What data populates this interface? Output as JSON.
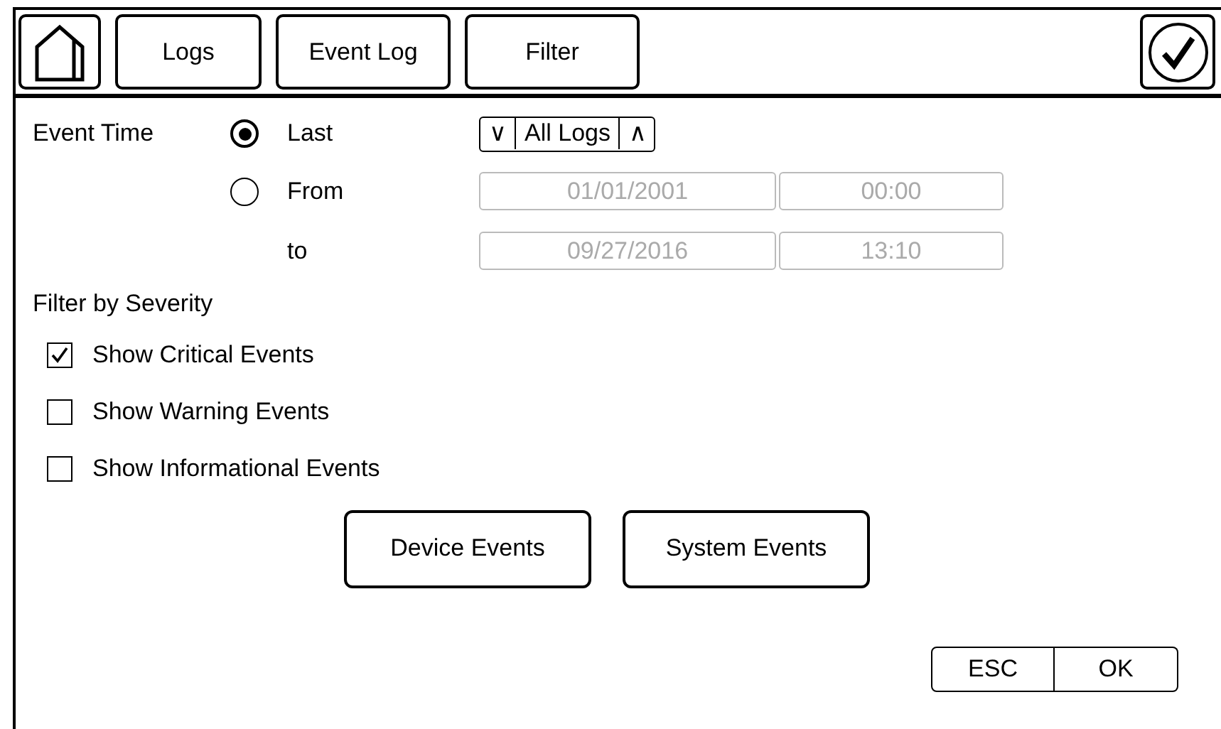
{
  "toolbar": {
    "tabs": [
      {
        "label": "Logs"
      },
      {
        "label": "Event Log"
      },
      {
        "label": "Filter"
      }
    ]
  },
  "event_time": {
    "label": "Event Time",
    "options": [
      {
        "label": "Last",
        "selected": true
      },
      {
        "label": "From",
        "selected": false
      }
    ],
    "spinner": {
      "down": "∨",
      "value": "All Logs",
      "up": "∧"
    },
    "from": {
      "date": "01/01/2001",
      "time": "00:00",
      "disabled": true
    },
    "to_label": "to",
    "to": {
      "date": "09/27/2016",
      "time": "13:10",
      "disabled": true
    }
  },
  "severity": {
    "label": "Filter by Severity",
    "items": [
      {
        "label": "Show Critical Events",
        "checked": true
      },
      {
        "label": "Show Warning Events",
        "checked": false
      },
      {
        "label": "Show Informational Events",
        "checked": false
      }
    ]
  },
  "buttons": [
    "Device Events",
    "System Events"
  ],
  "dialog_buttons": [
    "ESC",
    "OK"
  ]
}
